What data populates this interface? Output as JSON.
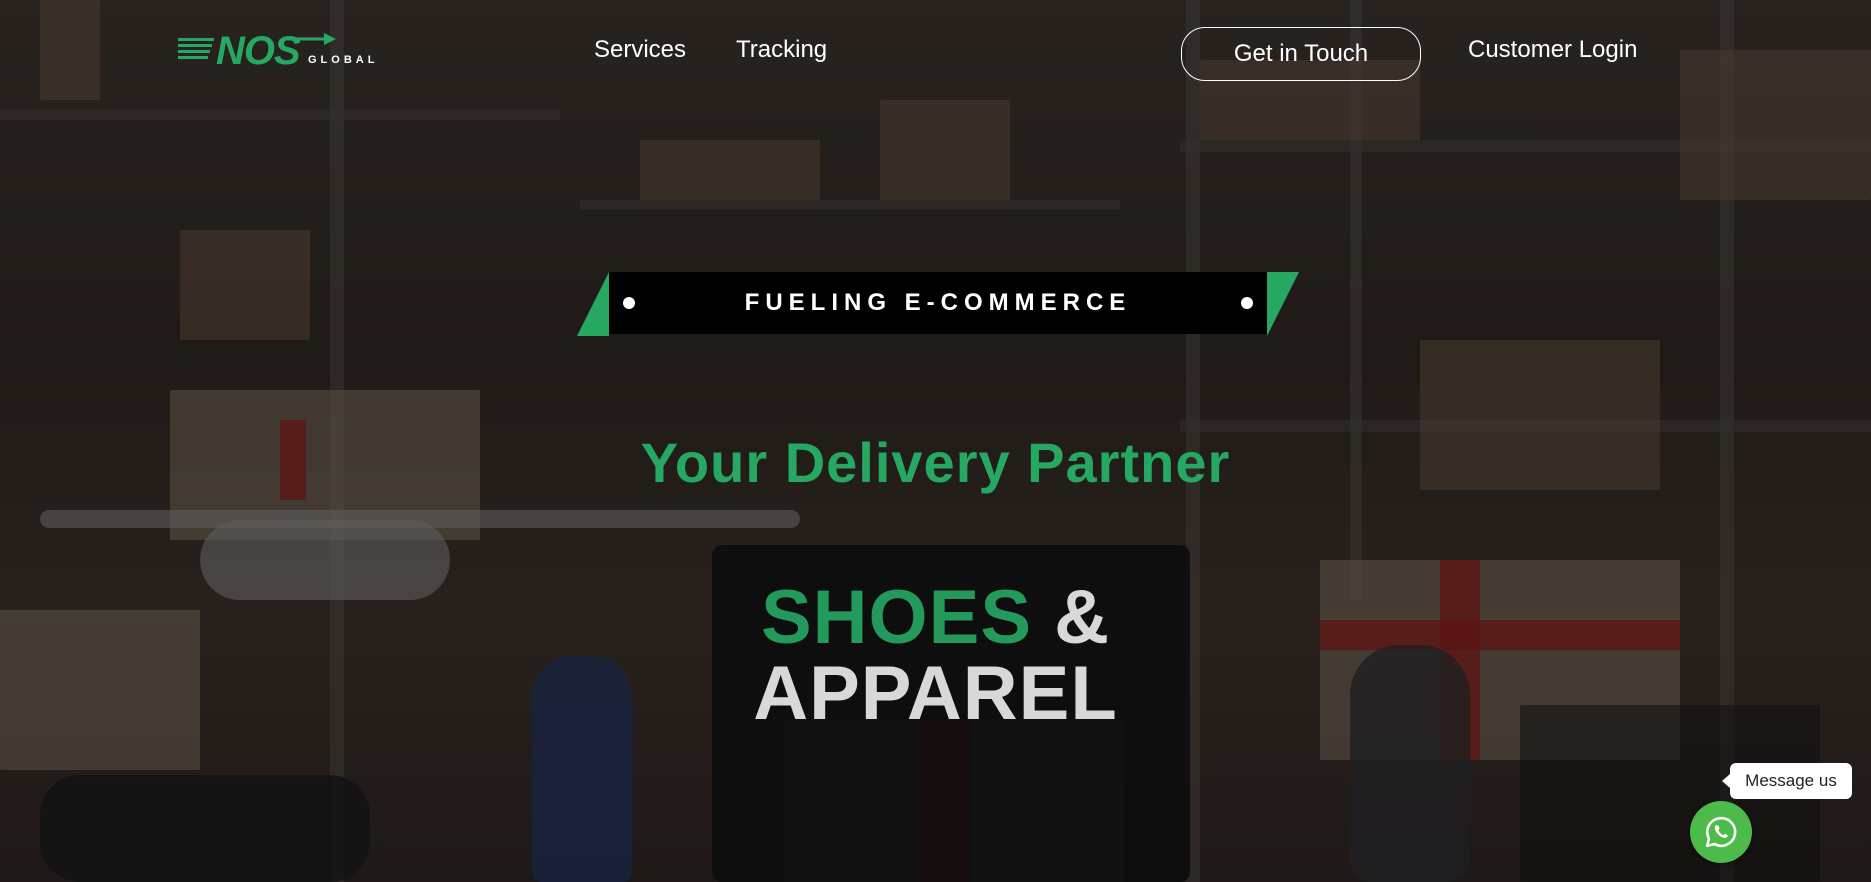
{
  "brand": {
    "logo_main": "NOS",
    "logo_sub": "GLOBAL",
    "accent_color": "#27a862"
  },
  "nav": {
    "items": [
      {
        "label": "Services"
      },
      {
        "label": "Tracking"
      }
    ],
    "cta_label": "Get in Touch",
    "login_label": "Customer Login"
  },
  "hero": {
    "banner_text": "FUELING E-COMMERCE",
    "tagline": "Your Delivery Partner",
    "headline_part1": "SHOES",
    "headline_part2": "&",
    "headline_part3": "APPAREL"
  },
  "chat_widget": {
    "bubble_label": "Message us",
    "icon": "whatsapp-icon",
    "color": "#4cbb4a"
  }
}
